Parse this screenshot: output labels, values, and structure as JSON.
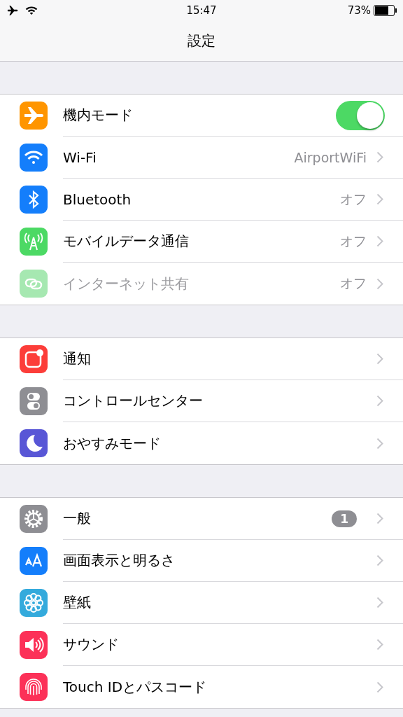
{
  "status_bar": {
    "time": "15:47",
    "battery": "73%"
  },
  "title": "設定",
  "groups": [
    {
      "rows": [
        {
          "color": "#ff9500",
          "label": "機内モード",
          "kind": "toggle",
          "on": true,
          "disabled": false
        },
        {
          "color": "#147efb",
          "label": "Wi-Fi",
          "kind": "link",
          "value": "AirportWiFi",
          "disabled": false
        },
        {
          "color": "#147efb",
          "label": "Bluetooth",
          "kind": "link",
          "value": "オフ",
          "disabled": false
        },
        {
          "color": "#4cd964",
          "label": "モバイルデータ通信",
          "kind": "link",
          "value": "オフ",
          "disabled": false
        },
        {
          "color": "#a6e8b1",
          "label": "インターネット共有",
          "kind": "link",
          "value": "オフ",
          "disabled": true
        }
      ]
    },
    {
      "rows": [
        {
          "color": "#fc3d39",
          "label": "通知",
          "kind": "link",
          "disabled": false
        },
        {
          "color": "#8e8e93",
          "label": "コントロールセンター",
          "kind": "link",
          "disabled": false
        },
        {
          "color": "#5856d6",
          "label": "おやすみモード",
          "kind": "link",
          "disabled": false
        }
      ]
    },
    {
      "rows": [
        {
          "color": "#8e8e93",
          "label": "一般",
          "kind": "link",
          "badge": "1",
          "disabled": false
        },
        {
          "color": "#147efb",
          "label": "画面表示と明るさ",
          "kind": "link",
          "disabled": false
        },
        {
          "color": "#34aadc",
          "label": "壁紙",
          "kind": "link",
          "disabled": false
        },
        {
          "color": "#fc3158",
          "label": "サウンド",
          "kind": "link",
          "disabled": false
        },
        {
          "color": "#fc3158",
          "label": "Touch IDとパスコード",
          "kind": "link",
          "disabled": false
        }
      ]
    }
  ]
}
